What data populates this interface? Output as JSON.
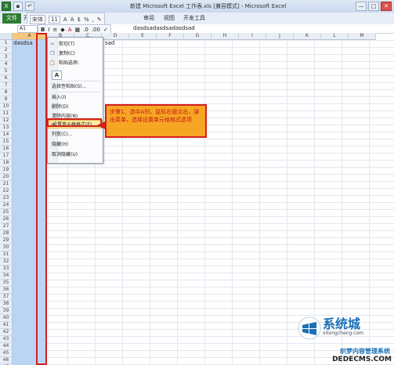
{
  "window": {
    "title": "新建 Microsoft Excel 工作表.xls [兼容模式] - Microsoft Excel",
    "buttons": [
      "—",
      "□",
      "✕"
    ]
  },
  "ribbon": {
    "file_tab": "文件",
    "tabs": [
      "开",
      "审阅",
      "视图",
      "开发工具"
    ]
  },
  "mini_toolbar": {
    "font": "宋体",
    "size": "11",
    "bold": "B",
    "italic": "I",
    "percent": "%",
    "comma": ","
  },
  "formula_bar": {
    "namebox": "A1",
    "content": "dasdsadasdsadasdsad"
  },
  "sheet": {
    "columns": [
      "A",
      "B",
      "C",
      "D",
      "E",
      "F",
      "G",
      "H",
      "I",
      "J",
      "K",
      "L",
      "M"
    ],
    "row_count": 47,
    "a1_value": "dasdsa",
    "c1_value": "sad"
  },
  "context_menu": {
    "items": [
      {
        "label": "剪切(T)",
        "icon": "cut-icon"
      },
      {
        "label": "复制(C)",
        "icon": "copy-icon"
      },
      {
        "label": "粘贴选项:",
        "icon": "paste-icon"
      },
      {
        "label": "选择性粘贴(S)...",
        "icon": ""
      },
      {
        "label": "插入(I)",
        "icon": ""
      },
      {
        "label": "删除(D)",
        "icon": ""
      },
      {
        "label": "清除内容(N)",
        "icon": ""
      },
      {
        "label": "设置单元格格式(F)...",
        "icon": "format-cells-icon"
      },
      {
        "label": "列宽(C)...",
        "icon": ""
      },
      {
        "label": "隐藏(H)",
        "icon": ""
      },
      {
        "label": "取消隐藏(U)",
        "icon": ""
      }
    ],
    "paste_glyph": "A"
  },
  "callout": {
    "text": "步骤1、选中A列，鼠标右键点击，弹出菜单，选择设置单元格格式选项"
  },
  "watermark": {
    "brand": "系统城",
    "url": "xitongcheng.com",
    "site": "织梦内容管理系统",
    "domain": "DEDECMS.COM"
  },
  "colors": {
    "accent_green": "#2e7d32",
    "highlight_red": "#d2201c",
    "callout_orange": "#f6a623",
    "selection_blue": "#bcd4f3"
  }
}
